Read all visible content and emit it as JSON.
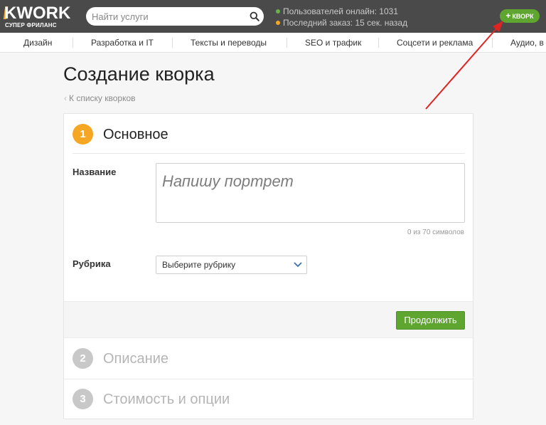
{
  "header": {
    "logo_text": "KWORK",
    "logo_subtitle": "СУПЕР ФРИЛАНС",
    "search_placeholder": "Найти услуги",
    "users_online": "Пользователей онлайн: 1031",
    "last_order": "Последний заказ: 15 сек. назад",
    "kwork_button": "КВОРК"
  },
  "nav": {
    "items": [
      "Дизайн",
      "Разработка и IT",
      "Тексты и переводы",
      "SEO и трафик",
      "Соцсети и реклама",
      "Аудио, в"
    ]
  },
  "page": {
    "title": "Создание кворка",
    "back_link": "К списку кворков"
  },
  "steps": [
    {
      "number": "1",
      "title": "Основное"
    },
    {
      "number": "2",
      "title": "Описание"
    },
    {
      "number": "3",
      "title": "Стоимость и опции"
    }
  ],
  "form": {
    "name_label": "Название",
    "name_placeholder": "Напишу портрет",
    "char_count": "0 из 70 символов",
    "category_label": "Рубрика",
    "category_value": "Выберите рубрику",
    "continue_button": "Продолжить"
  },
  "colors": {
    "header_bg": "#4a4a4a",
    "accent_green": "#5ea62f",
    "accent_orange": "#f5a623",
    "annotation_red": "#e02424"
  }
}
